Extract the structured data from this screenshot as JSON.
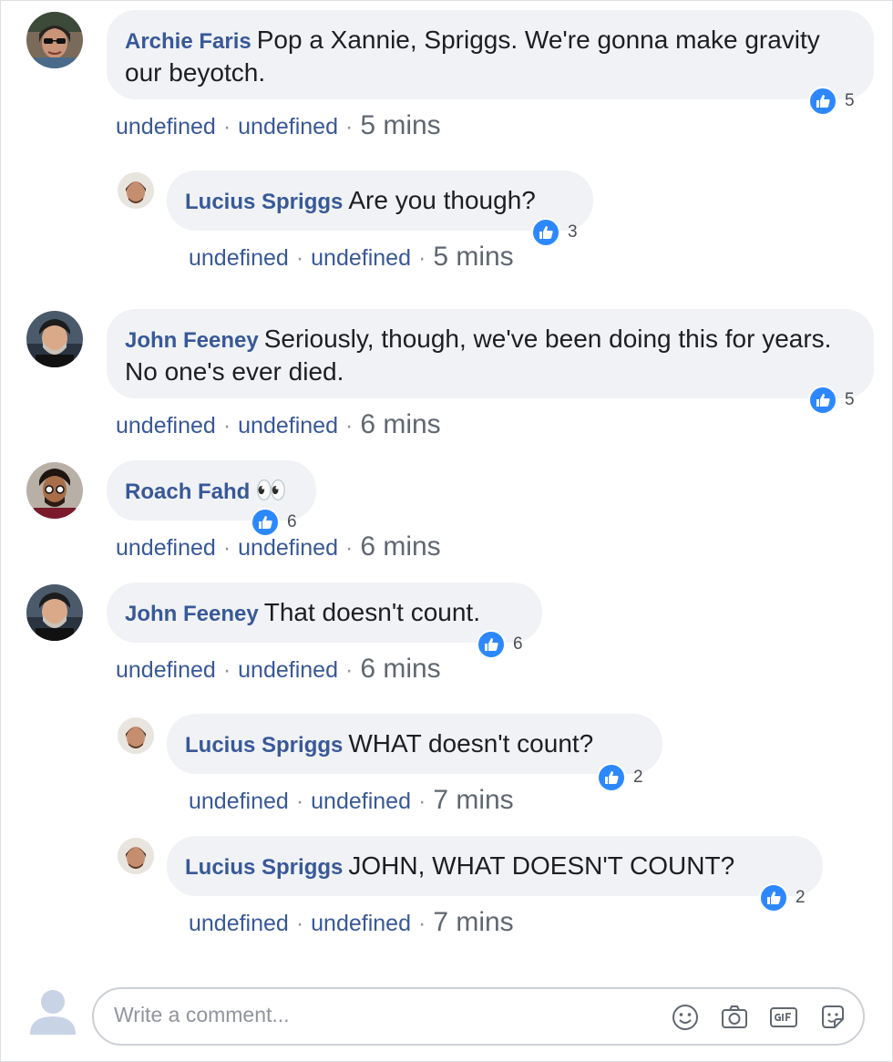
{
  "comments": [
    {
      "author": "Archie Faris",
      "text": "Pop a Xannie, Spriggs. We're gonna make gravity our beyotch.",
      "reactions": "5",
      "action1": "undefined",
      "action2": "undefined",
      "time": "5 mins"
    },
    {
      "author": "Lucius Spriggs",
      "text": "Are you though?",
      "reactions": "3",
      "action1": "undefined",
      "action2": "undefined",
      "time": "5 mins"
    },
    {
      "author": "John Feeney",
      "text": "Seriously, though, we've been doing this for years. No one's ever died.",
      "reactions": "5",
      "action1": "undefined",
      "action2": "undefined",
      "time": "6 mins"
    },
    {
      "author": "Roach Fahd",
      "text": "👀",
      "reactions": "6",
      "action1": "undefined",
      "action2": "undefined",
      "time": "6 mins"
    },
    {
      "author": "John Feeney",
      "text": "That doesn't count.",
      "reactions": "6",
      "action1": "undefined",
      "action2": "undefined",
      "time": "6 mins"
    },
    {
      "author": "Lucius Spriggs",
      "text": "WHAT doesn't count?",
      "reactions": "2",
      "action1": "undefined",
      "action2": "undefined",
      "time": "7 mins"
    },
    {
      "author": "Lucius Spriggs",
      "text": "JOHN, WHAT DOESN'T COUNT?",
      "reactions": "2",
      "action1": "undefined",
      "action2": "undefined",
      "time": "7 mins"
    }
  ],
  "separator": "·",
  "composer": {
    "placeholder": "Write a comment...",
    "icons": [
      "emoji-icon",
      "camera-icon",
      "gif-icon",
      "sticker-icon"
    ]
  },
  "colors": {
    "author_link": "#385898",
    "bubble_bg": "#f0f2f5",
    "like_blue": "#2d88ff",
    "meta_gray": "#606770"
  }
}
